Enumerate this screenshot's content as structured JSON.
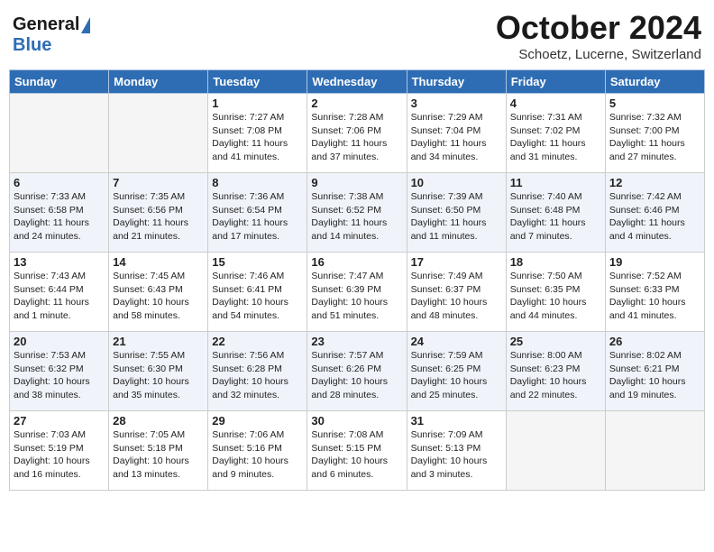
{
  "header": {
    "logo_general": "General",
    "logo_blue": "Blue",
    "month": "October 2024",
    "location": "Schoetz, Lucerne, Switzerland"
  },
  "weekdays": [
    "Sunday",
    "Monday",
    "Tuesday",
    "Wednesday",
    "Thursday",
    "Friday",
    "Saturday"
  ],
  "weeks": [
    [
      {
        "day": "",
        "info": ""
      },
      {
        "day": "",
        "info": ""
      },
      {
        "day": "1",
        "info": "Sunrise: 7:27 AM\nSunset: 7:08 PM\nDaylight: 11 hours and 41 minutes."
      },
      {
        "day": "2",
        "info": "Sunrise: 7:28 AM\nSunset: 7:06 PM\nDaylight: 11 hours and 37 minutes."
      },
      {
        "day": "3",
        "info": "Sunrise: 7:29 AM\nSunset: 7:04 PM\nDaylight: 11 hours and 34 minutes."
      },
      {
        "day": "4",
        "info": "Sunrise: 7:31 AM\nSunset: 7:02 PM\nDaylight: 11 hours and 31 minutes."
      },
      {
        "day": "5",
        "info": "Sunrise: 7:32 AM\nSunset: 7:00 PM\nDaylight: 11 hours and 27 minutes."
      }
    ],
    [
      {
        "day": "6",
        "info": "Sunrise: 7:33 AM\nSunset: 6:58 PM\nDaylight: 11 hours and 24 minutes."
      },
      {
        "day": "7",
        "info": "Sunrise: 7:35 AM\nSunset: 6:56 PM\nDaylight: 11 hours and 21 minutes."
      },
      {
        "day": "8",
        "info": "Sunrise: 7:36 AM\nSunset: 6:54 PM\nDaylight: 11 hours and 17 minutes."
      },
      {
        "day": "9",
        "info": "Sunrise: 7:38 AM\nSunset: 6:52 PM\nDaylight: 11 hours and 14 minutes."
      },
      {
        "day": "10",
        "info": "Sunrise: 7:39 AM\nSunset: 6:50 PM\nDaylight: 11 hours and 11 minutes."
      },
      {
        "day": "11",
        "info": "Sunrise: 7:40 AM\nSunset: 6:48 PM\nDaylight: 11 hours and 7 minutes."
      },
      {
        "day": "12",
        "info": "Sunrise: 7:42 AM\nSunset: 6:46 PM\nDaylight: 11 hours and 4 minutes."
      }
    ],
    [
      {
        "day": "13",
        "info": "Sunrise: 7:43 AM\nSunset: 6:44 PM\nDaylight: 11 hours and 1 minute."
      },
      {
        "day": "14",
        "info": "Sunrise: 7:45 AM\nSunset: 6:43 PM\nDaylight: 10 hours and 58 minutes."
      },
      {
        "day": "15",
        "info": "Sunrise: 7:46 AM\nSunset: 6:41 PM\nDaylight: 10 hours and 54 minutes."
      },
      {
        "day": "16",
        "info": "Sunrise: 7:47 AM\nSunset: 6:39 PM\nDaylight: 10 hours and 51 minutes."
      },
      {
        "day": "17",
        "info": "Sunrise: 7:49 AM\nSunset: 6:37 PM\nDaylight: 10 hours and 48 minutes."
      },
      {
        "day": "18",
        "info": "Sunrise: 7:50 AM\nSunset: 6:35 PM\nDaylight: 10 hours and 44 minutes."
      },
      {
        "day": "19",
        "info": "Sunrise: 7:52 AM\nSunset: 6:33 PM\nDaylight: 10 hours and 41 minutes."
      }
    ],
    [
      {
        "day": "20",
        "info": "Sunrise: 7:53 AM\nSunset: 6:32 PM\nDaylight: 10 hours and 38 minutes."
      },
      {
        "day": "21",
        "info": "Sunrise: 7:55 AM\nSunset: 6:30 PM\nDaylight: 10 hours and 35 minutes."
      },
      {
        "day": "22",
        "info": "Sunrise: 7:56 AM\nSunset: 6:28 PM\nDaylight: 10 hours and 32 minutes."
      },
      {
        "day": "23",
        "info": "Sunrise: 7:57 AM\nSunset: 6:26 PM\nDaylight: 10 hours and 28 minutes."
      },
      {
        "day": "24",
        "info": "Sunrise: 7:59 AM\nSunset: 6:25 PM\nDaylight: 10 hours and 25 minutes."
      },
      {
        "day": "25",
        "info": "Sunrise: 8:00 AM\nSunset: 6:23 PM\nDaylight: 10 hours and 22 minutes."
      },
      {
        "day": "26",
        "info": "Sunrise: 8:02 AM\nSunset: 6:21 PM\nDaylight: 10 hours and 19 minutes."
      }
    ],
    [
      {
        "day": "27",
        "info": "Sunrise: 7:03 AM\nSunset: 5:19 PM\nDaylight: 10 hours and 16 minutes."
      },
      {
        "day": "28",
        "info": "Sunrise: 7:05 AM\nSunset: 5:18 PM\nDaylight: 10 hours and 13 minutes."
      },
      {
        "day": "29",
        "info": "Sunrise: 7:06 AM\nSunset: 5:16 PM\nDaylight: 10 hours and 9 minutes."
      },
      {
        "day": "30",
        "info": "Sunrise: 7:08 AM\nSunset: 5:15 PM\nDaylight: 10 hours and 6 minutes."
      },
      {
        "day": "31",
        "info": "Sunrise: 7:09 AM\nSunset: 5:13 PM\nDaylight: 10 hours and 3 minutes."
      },
      {
        "day": "",
        "info": ""
      },
      {
        "day": "",
        "info": ""
      }
    ]
  ]
}
